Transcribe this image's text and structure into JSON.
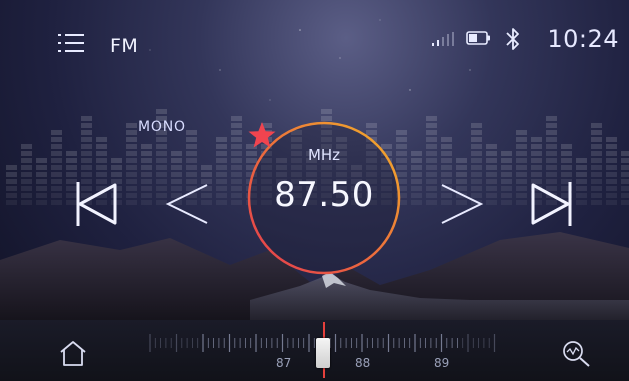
{
  "header": {
    "band": "FM",
    "time": "10:24",
    "icons": [
      "menu-icon",
      "signal-icon",
      "battery-icon",
      "bluetooth-icon"
    ]
  },
  "radio": {
    "stereo_mode": "MONO",
    "unit": "MHz",
    "frequency": "87.50",
    "favorite": true
  },
  "controls": {
    "icons": [
      "previous-station-icon",
      "seek-back-icon",
      "seek-forward-icon",
      "next-station-icon"
    ]
  },
  "tuner": {
    "labels": [
      "87",
      "88",
      "89"
    ]
  },
  "footer": {
    "icons": [
      "home-icon",
      "search-icon"
    ]
  },
  "colors": {
    "ring_start": "#f1b129",
    "ring_end": "#e33a4f",
    "star": "#f0444f",
    "needle": "#e5403c"
  }
}
